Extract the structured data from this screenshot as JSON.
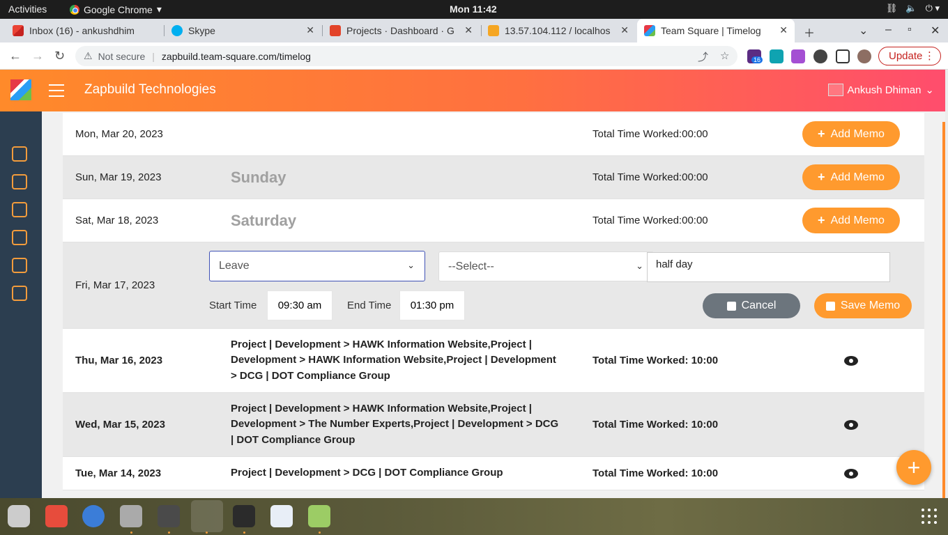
{
  "system": {
    "activities": "Activities",
    "app_name": "Google Chrome",
    "clock": "Mon 11:42"
  },
  "tabs": [
    {
      "title": "Inbox (16) - ankushdhim"
    },
    {
      "title": "Skype"
    },
    {
      "title": "Projects · Dashboard · G"
    },
    {
      "title": "13.57.104.112 / localhos"
    },
    {
      "title": "Team Square | Timelog"
    }
  ],
  "addressbar": {
    "security": "Not secure",
    "url": "zapbuild.team-square.com/timelog",
    "update_label": "Update",
    "ext_badge": "16"
  },
  "header": {
    "brand": "Zapbuild Technologies",
    "user": "Ankush Dhiman"
  },
  "rows": [
    {
      "date": "Mon, Mar 20, 2023",
      "day": "",
      "total": "Total Time Worked:00:00",
      "action": "Add Memo"
    },
    {
      "date": "Sun, Mar 19, 2023",
      "day": "Sunday",
      "total": "Total Time Worked:00:00",
      "action": "Add Memo"
    },
    {
      "date": "Sat, Mar 18, 2023",
      "day": "Saturday",
      "total": "Total Time Worked:00:00",
      "action": "Add Memo"
    }
  ],
  "edit_row": {
    "date": "Fri, Mar 17, 2023",
    "type": "Leave",
    "subtype": "--Select--",
    "note": "half day",
    "start_label": "Start Time",
    "start_time": "09:30 am",
    "end_label": "End Time",
    "end_time": "01:30 pm",
    "cancel": "Cancel",
    "save": "Save Memo"
  },
  "logged": [
    {
      "date": "Thu, Mar 16, 2023",
      "desc": "Project | Development > HAWK Information Website,Project | Development > HAWK Information Website,Project | Development > DCG | DOT Compliance Group",
      "total": "Total Time Worked: 10:00"
    },
    {
      "date": "Wed, Mar 15, 2023",
      "desc": "Project | Development > HAWK Information Website,Project | Development > The Number Experts,Project | Development > DCG | DOT Compliance Group",
      "total": "Total Time Worked: 10:00"
    },
    {
      "date": "Tue, Mar 14, 2023",
      "desc": "Project | Development > DCG | DOT Compliance Group",
      "total": "Total Time Worked: 10:00"
    }
  ],
  "fab": "+",
  "colors": {
    "accent": "#ff9a2e",
    "sidebar": "#2c3e50",
    "cancel": "#6c757d"
  }
}
